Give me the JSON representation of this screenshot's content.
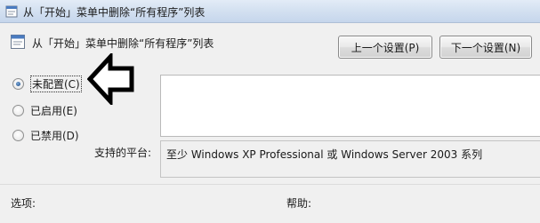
{
  "window": {
    "title": "从「开始」菜单中删除“所有程序”列表"
  },
  "header": {
    "title": "从「开始」菜单中删除“所有程序”列表",
    "prev_button": "上一个设置(P)",
    "next_button": "下一个设置(N)"
  },
  "state_options": [
    {
      "label": "未配置(C)",
      "checked": true
    },
    {
      "label": "已启用(E)",
      "checked": false
    },
    {
      "label": "已禁用(D)",
      "checked": false
    }
  ],
  "platform": {
    "label": "支持的平台:",
    "value": "至少 Windows XP Professional 或 Windows Server 2003 系列"
  },
  "bottom": {
    "options_label": "选项:",
    "help_label": "帮助:"
  },
  "icons": {
    "title_icon": "policy-icon",
    "header_icon": "policy-setting-icon",
    "annotation": "left-arrow-icon"
  }
}
